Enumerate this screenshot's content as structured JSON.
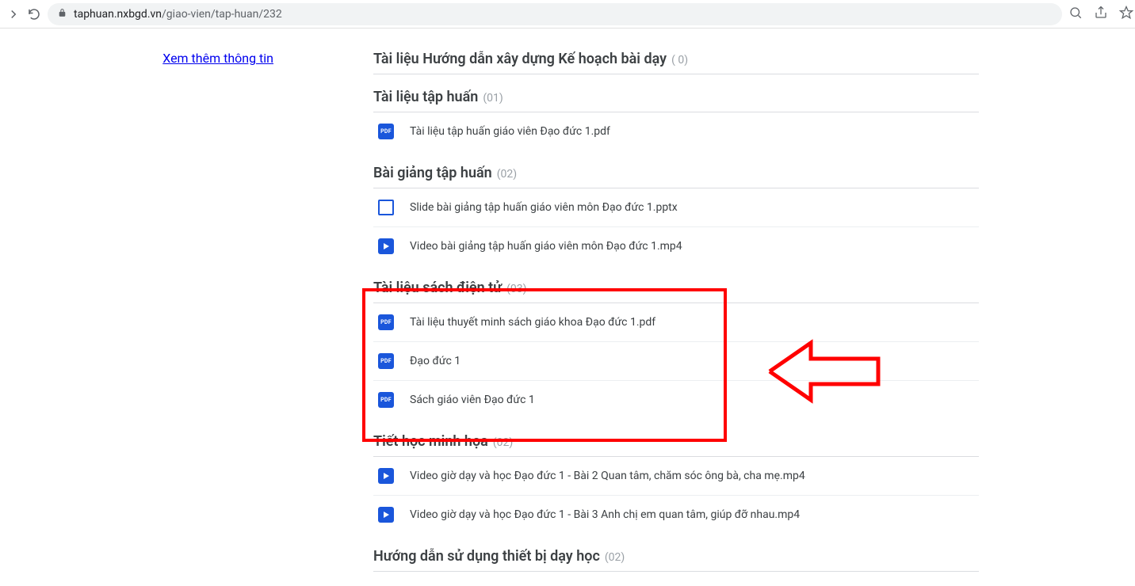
{
  "browser": {
    "url_host": "taphuan.nxbgd.vn",
    "url_path": "/giao-vien/tap-huan/232"
  },
  "sidebar": {
    "more_info_label": "Xem thêm thông tin"
  },
  "sections": [
    {
      "title": "Tài liệu Hướng dẫn xây dựng Kế hoạch bài dạy",
      "count": "( 0)",
      "items": []
    },
    {
      "title": "Tài liệu tập huấn",
      "count": "(01)",
      "items": [
        {
          "icon": "pdf",
          "name": "Tài liệu tập huấn giáo viên Đạo đức 1.pdf"
        }
      ]
    },
    {
      "title": "Bài giảng tập huấn",
      "count": "(02)",
      "items": [
        {
          "icon": "slide",
          "name": "Slide bài giảng tập huấn giáo viên môn Đạo đức 1.pptx"
        },
        {
          "icon": "video",
          "name": "Video bài giảng tập huấn giáo viên môn Đạo đức 1.mp4"
        }
      ]
    },
    {
      "title": "Tài liệu sách điện tử",
      "count": "(03)",
      "items": [
        {
          "icon": "pdf",
          "name": "Tài liệu thuyết minh sách giáo khoa Đạo đức 1.pdf"
        },
        {
          "icon": "pdf",
          "name": "Đạo đức 1"
        },
        {
          "icon": "pdf",
          "name": "Sách giáo viên Đạo đức 1"
        }
      ]
    },
    {
      "title": "Tiết học minh họa",
      "count": "(02)",
      "items": [
        {
          "icon": "video",
          "name": "Video giờ dạy và học Đạo đức 1 - Bài 2 Quan tâm, chăm sóc ông bà, cha mẹ.mp4"
        },
        {
          "icon": "video",
          "name": "Video giờ dạy và học Đạo đức 1 - Bài 3 Anh chị em quan tâm, giúp đỡ nhau.mp4"
        }
      ]
    },
    {
      "title": "Hướng dẫn sử dụng thiết bị dạy học",
      "count": "(02)",
      "items": []
    }
  ],
  "icon_labels": {
    "pdf": "PDF"
  }
}
